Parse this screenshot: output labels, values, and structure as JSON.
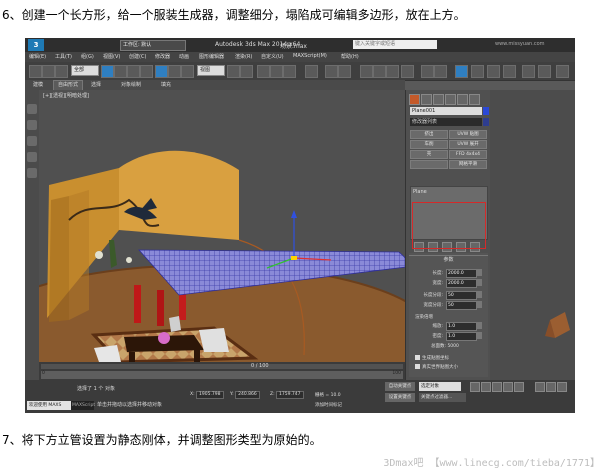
{
  "doc": {
    "step6": "6、创建一个长方形，给一个服装生成器，调整细分，塌陷成可编辑多边形，放在上方。",
    "step7": "7、将下方立管设置为静态刚体，并调整图形类型为原始的。",
    "watermark": "3Dmax吧 【www.linecg.com/tieba/1771】"
  },
  "titlebar": {
    "logo": "3",
    "workspace": "工作区: 默认",
    "app": "Autodesk 3ds Max  2014 x64",
    "file": "场景.max",
    "search_placeholder": "键入关键字或短语",
    "site": "www.missyuan.com"
  },
  "menubar": [
    "编辑(E)",
    "工具(T)",
    "组(G)",
    "视图(V)",
    "创建(C)",
    "修改器",
    "动画",
    "图形编辑器",
    "渲染(R)",
    "自定义(U)",
    "MAXScript(M)",
    "帮助(H)"
  ],
  "toolbar": {
    "filter": "全部",
    "view": "视图"
  },
  "ribbon": [
    "建模",
    "自由形式",
    "选择",
    "对象绘制",
    "填充"
  ],
  "viewport": {
    "label": "[+][透视][明暗处理]"
  },
  "timeline": {
    "frame": "0 / 100",
    "ruler_start": "0",
    "ruler_end": "100"
  },
  "right_panel": {
    "object_name": "Plane001",
    "modifier_list": "修改器列表",
    "buttons": [
      "挤出",
      "UVW 贴图",
      "车削",
      "UVW 展开",
      "壳",
      "FFD 4x4x4",
      "",
      "网格平滑"
    ],
    "stack_item": "Plane",
    "params_title": "参数",
    "length_label": "长度:",
    "length_value": "2000.0",
    "width_label": "宽度:",
    "width_value": "2000.0",
    "lseg_label": "长度分段:",
    "lseg_value": "50",
    "wseg_label": "宽度分段:",
    "wseg_value": "50",
    "render_mult": "渲染倍增",
    "scale_label": "缩放:",
    "scale_value": "1.0",
    "density_label": "密度:",
    "density_value": "1.0",
    "total_faces": "总面数: 5000",
    "chk1": "生成贴图坐标",
    "chk2": "真实世界贴图大小"
  },
  "status": {
    "welcome": "欢迎使用 MAXS",
    "maxscript": "MAXScript",
    "selected": "选择了 1 个 对象",
    "hint": "单击并拖动以选择并移动对象",
    "x": "1905.798",
    "y": "240.866",
    "z": "1759.747",
    "grid": "栅格 = 10.0",
    "add_time": "添加时间标记",
    "autokey": "自动关键点",
    "setkey": "设置关键点",
    "sel_option": "选定对象",
    "key_filter": "关键点过滤器..."
  }
}
